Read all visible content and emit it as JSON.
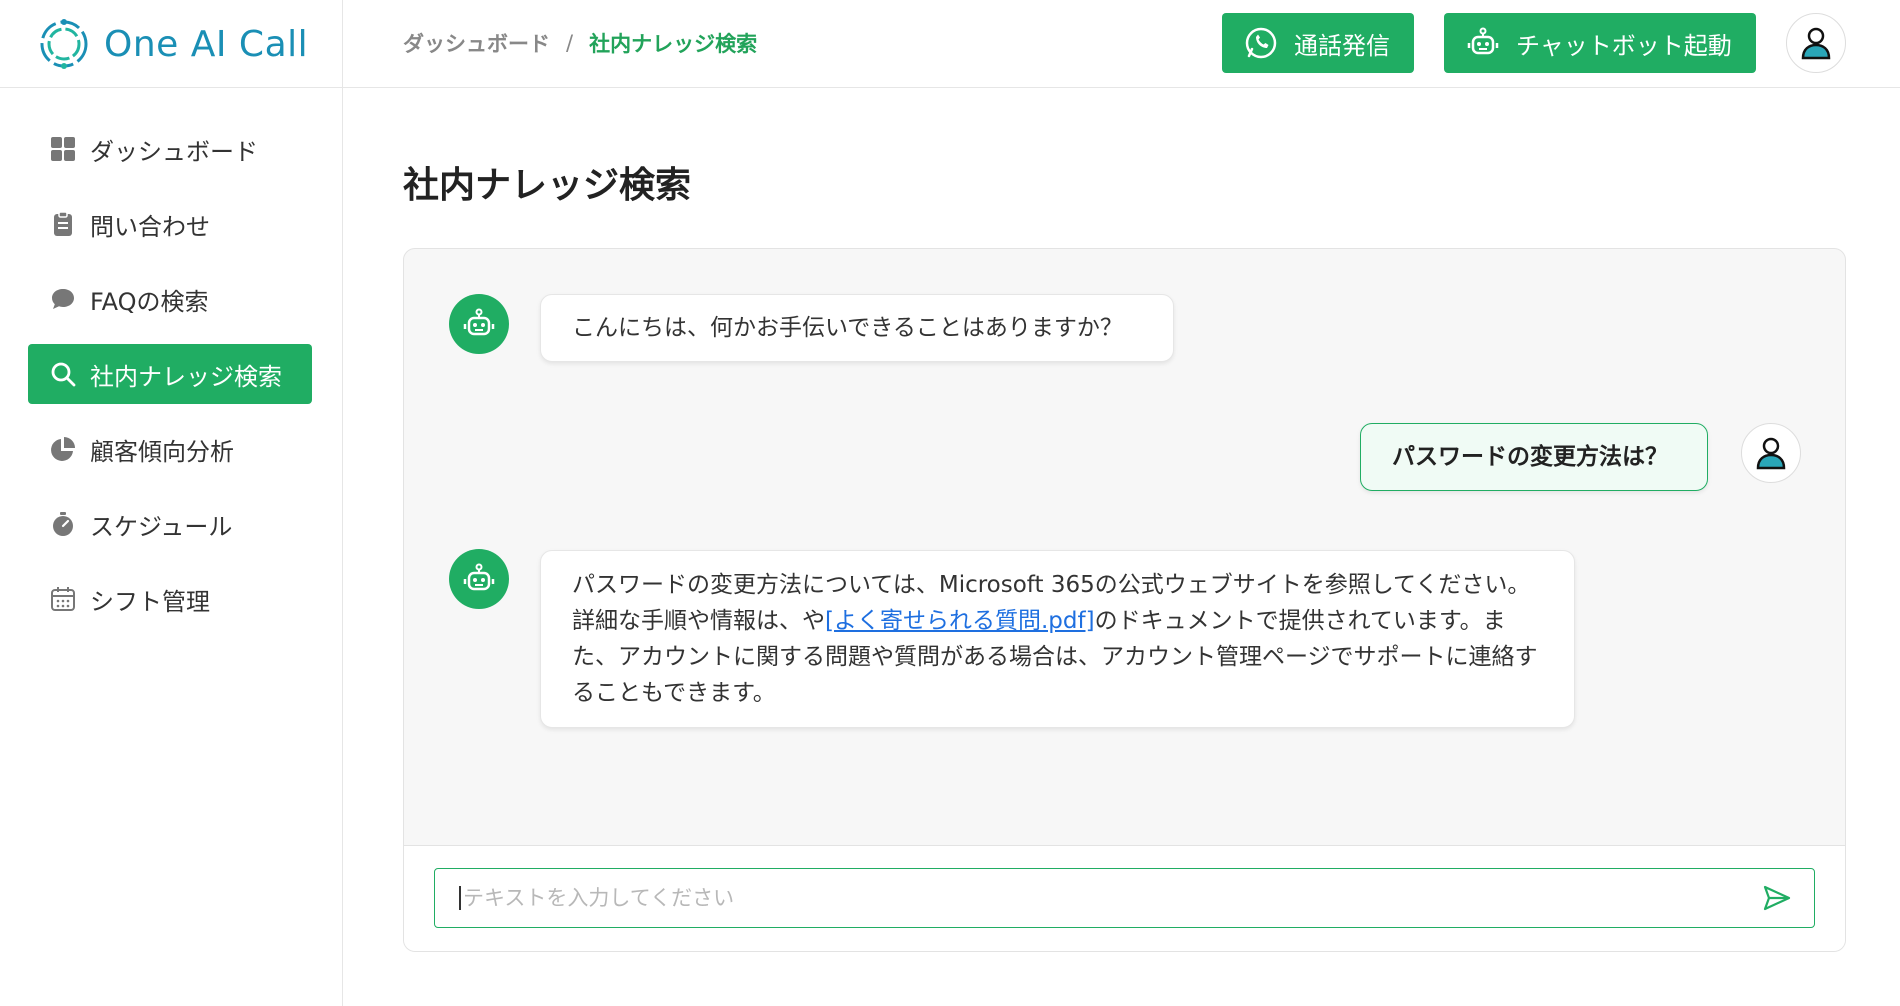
{
  "app": {
    "logo_text": "One AI Call",
    "brand_color": "#20ad63",
    "logo_color": "#1a8fb5"
  },
  "header": {
    "breadcrumb": {
      "parent": "ダッシュボード",
      "separator": "/",
      "current": "社内ナレッジ検索"
    },
    "call_button": {
      "label": "通話発信",
      "icon": "phone-icon"
    },
    "chatbot_button": {
      "label": "チャットボット起動",
      "icon": "robot-icon"
    },
    "avatar_icon": "user-icon"
  },
  "sidebar": {
    "items": [
      {
        "label": "ダッシュボード",
        "icon": "grid-icon",
        "active": false
      },
      {
        "label": "問い合わせ",
        "icon": "clipboard-icon",
        "active": false
      },
      {
        "label": "FAQの検索",
        "icon": "chat-bubble-icon",
        "active": false
      },
      {
        "label": "社内ナレッジ検索",
        "icon": "search-icon",
        "active": true
      },
      {
        "label": "顧客傾向分析",
        "icon": "pie-chart-icon",
        "active": false
      },
      {
        "label": "スケジュール",
        "icon": "stopwatch-icon",
        "active": false
      },
      {
        "label": "シフト管理",
        "icon": "calendar-icon",
        "active": false
      }
    ]
  },
  "main": {
    "title": "社内ナレッジ検索",
    "messages": [
      {
        "role": "bot",
        "text": "こんにちは、何かお手伝いできることはありますか？"
      },
      {
        "role": "user",
        "text": "パスワードの変更方法は？"
      },
      {
        "role": "bot",
        "text_before": "パスワードの変更方法については、Microsoft 365の公式ウェブサイトを参照してください。詳細な手順や情報は、や",
        "link_text": "[よく寄せられる質問.pdf]",
        "text_after": "のドキュメントで提供されています。また、アカウントに関する問題や質問がある場合は、アカウント管理ページでサポートに連絡することもできます。"
      }
    ],
    "input": {
      "placeholder": "テキストを入力してください",
      "value": "",
      "send_icon": "send-icon"
    }
  }
}
